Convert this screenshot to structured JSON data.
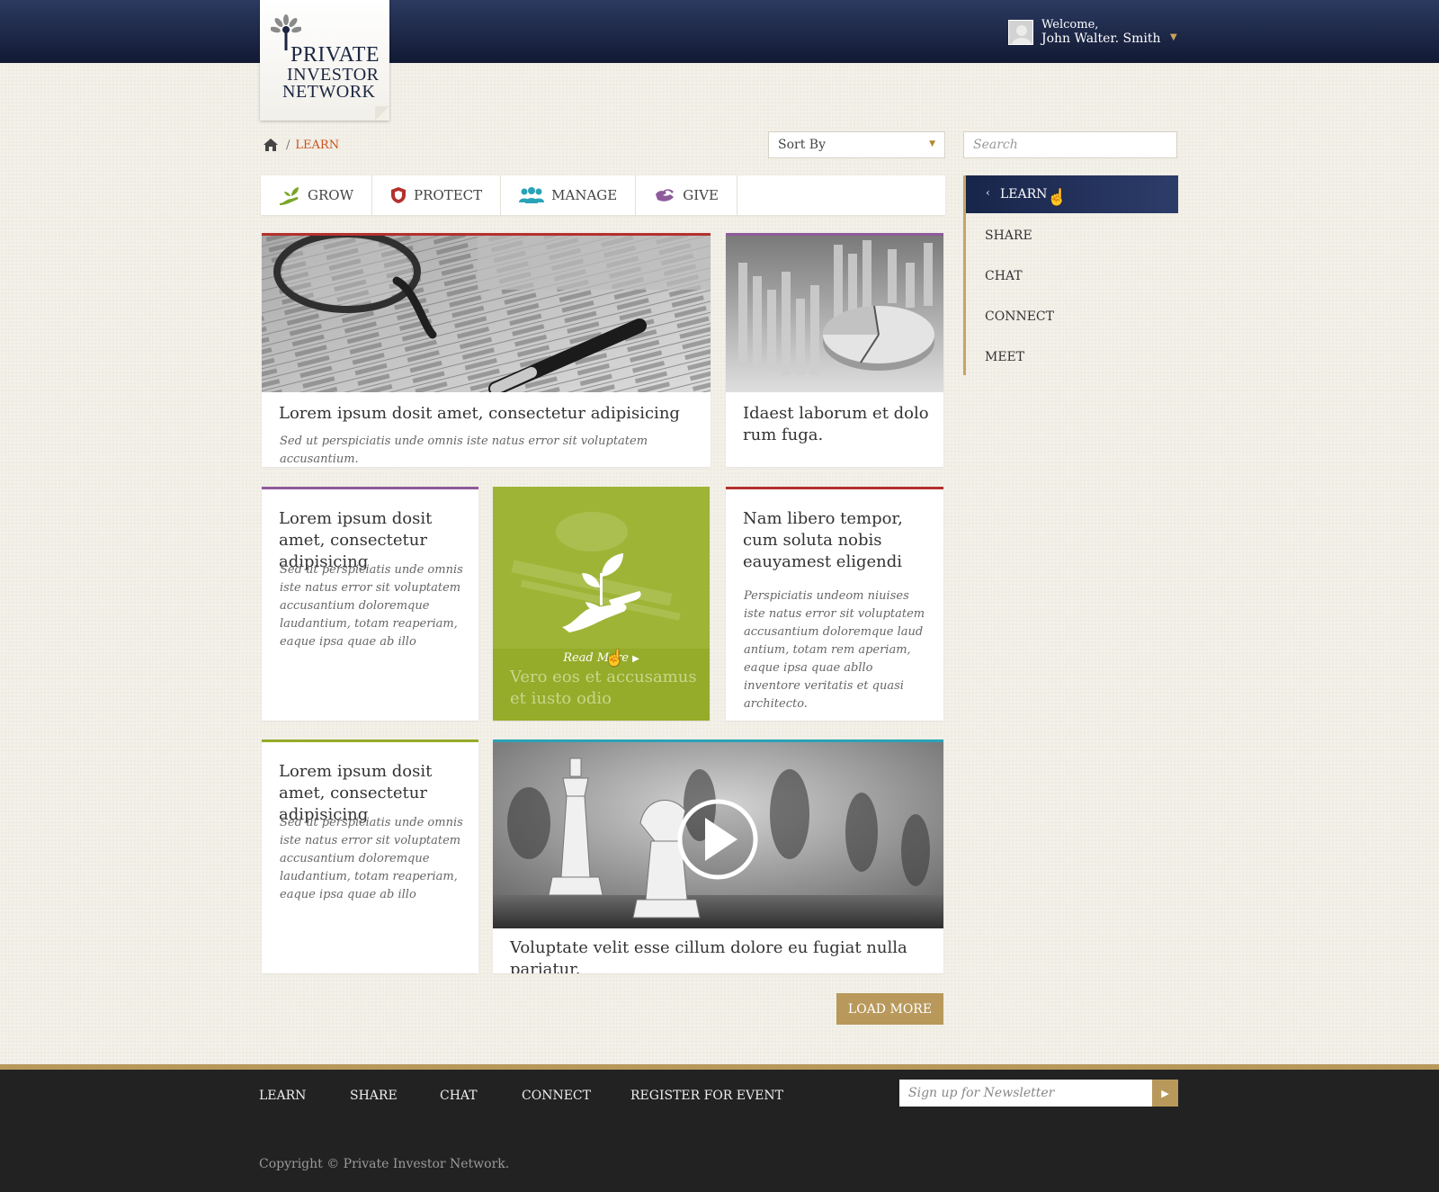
{
  "header": {
    "logo": {
      "line1": "PRIVATE",
      "line2": "INVESTOR",
      "line3": "NETWORK"
    },
    "user": {
      "welcome": "Welcome,",
      "name": "John Walter. Smith"
    }
  },
  "breadcrumb": {
    "current": "LEARN"
  },
  "controls": {
    "sort_label": "Sort By",
    "search_placeholder": "Search"
  },
  "tabs": [
    {
      "label": "GROW",
      "icon": "sprout-hand-icon"
    },
    {
      "label": "PROTECT",
      "icon": "shield-icon"
    },
    {
      "label": "MANAGE",
      "icon": "people-icon"
    },
    {
      "label": "GIVE",
      "icon": "heart-hands-icon"
    }
  ],
  "cards": {
    "c1": {
      "title": "Lorem ipsum dosit amet, consectetur adipisicing",
      "text": "Sed ut perspiciatis unde omnis iste natus error sit voluptatem accusantium.",
      "accent": "#b3312d"
    },
    "c2": {
      "title": "Idaest laborum et dolo rum fuga.",
      "accent": "#8e5a9b"
    },
    "c3": {
      "title": "Lorem ipsum dosit amet, consectetur adipisicing",
      "text": "Sed ut perspiciatis unde omnis iste natus error sit voluptatem accusantium doloremque laudantium, totam reaperiam, eaque ipsa quae ab illo",
      "accent": "#8e5a9b"
    },
    "c4": {
      "title": "Vero eos et accusamus et iusto odio",
      "read_more": "Read More",
      "accent": "#95ab2a"
    },
    "c5": {
      "title": "Nam libero tempor, cum soluta nobis eauyamest eligendi",
      "text": "Perspiciatis undeom niuises iste natus error sit voluptatem accusantium doloremque laud antium, totam rem aperiam, eaque ipsa quae abllo inventore veritatis et quasi architecto.",
      "accent": "#b3312d"
    },
    "c6": {
      "title": "Lorem ipsum dosit amet, consectetur adipisicing",
      "text": "Sed ut perspiciatis unde omnis iste natus error sit voluptatem accusantium doloremque laudantium, totam reaperiam, eaque ipsa quae ab illo",
      "accent": "#95ab2a"
    },
    "c7": {
      "title": "Voluptate velit esse cillum dolore eu fugiat nulla pariatur.",
      "accent": "#2aa3b8"
    }
  },
  "load_more": "LOAD MORE",
  "sidenav": {
    "active": "LEARN",
    "items": [
      "SHARE",
      "CHAT",
      "CONNECT",
      "MEET"
    ]
  },
  "footer": {
    "nav": [
      "LEARN",
      "SHARE",
      "CHAT",
      "CONNECT",
      "REGISTER FOR EVENT"
    ],
    "newsletter_placeholder": "Sign up for Newsletter",
    "copyright": "Copyright © Private Investor Network."
  },
  "colors": {
    "navy": "#18254a",
    "gold": "#b8995b",
    "breadcrumb": "#c8511c",
    "green": "#95ab2a"
  }
}
